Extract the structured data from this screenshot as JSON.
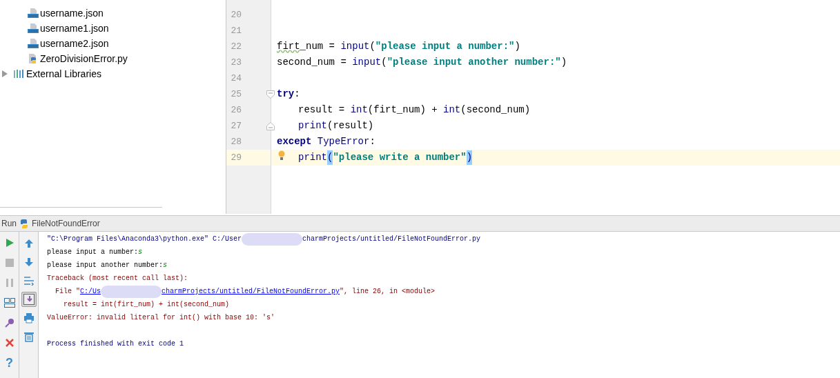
{
  "project_tree": {
    "files": [
      {
        "kind": "json",
        "label": "username.json"
      },
      {
        "kind": "json",
        "label": "username1.json"
      },
      {
        "kind": "json",
        "label": "username2.json"
      },
      {
        "kind": "python",
        "label": "ZeroDivisionError.py"
      }
    ],
    "external": {
      "label": "External Libraries",
      "expanded": false
    }
  },
  "editor": {
    "lines": [
      {
        "number": "20",
        "indented": false,
        "current": false,
        "bulb": false,
        "fold_start": false,
        "fold_end": false
      },
      {
        "number": "21",
        "indented": false,
        "current": false,
        "bulb": false,
        "fold_start": false,
        "fold_end": false
      },
      {
        "number": "22",
        "indented": false,
        "current": false,
        "bulb": false,
        "fold_start": false,
        "fold_end": false,
        "tokens": [
          {
            "kind": "typo",
            "text": "firt"
          },
          {
            "kind": "plain",
            "text": "_num = "
          },
          {
            "kind": "builtin",
            "text": "input"
          },
          {
            "kind": "plain",
            "text": "("
          },
          {
            "kind": "string",
            "text": "\"please input a number:\""
          },
          {
            "kind": "plain",
            "text": ")"
          }
        ]
      },
      {
        "number": "23",
        "indented": false,
        "current": false,
        "bulb": false,
        "fold_start": false,
        "fold_end": false,
        "tokens": [
          {
            "kind": "plain",
            "text": "second_num = "
          },
          {
            "kind": "builtin",
            "text": "input"
          },
          {
            "kind": "plain",
            "text": "("
          },
          {
            "kind": "string",
            "text": "\"please input another number:\""
          },
          {
            "kind": "plain",
            "text": ")"
          }
        ]
      },
      {
        "number": "24",
        "indented": false,
        "current": false,
        "bulb": false,
        "fold_start": false,
        "fold_end": false
      },
      {
        "number": "25",
        "indented": false,
        "current": false,
        "bulb": false,
        "fold_start": true,
        "fold_end": false,
        "tokens": [
          {
            "kind": "keyword",
            "text": "try"
          },
          {
            "kind": "plain",
            "text": ":"
          }
        ]
      },
      {
        "number": "26",
        "indented": true,
        "current": false,
        "bulb": false,
        "fold_start": false,
        "fold_end": false,
        "tokens": [
          {
            "kind": "plain",
            "text": "result = "
          },
          {
            "kind": "builtin",
            "text": "int"
          },
          {
            "kind": "plain",
            "text": "(firt_num) + "
          },
          {
            "kind": "builtin",
            "text": "int"
          },
          {
            "kind": "plain",
            "text": "(second_num)"
          }
        ]
      },
      {
        "number": "27",
        "indented": true,
        "current": false,
        "bulb": false,
        "fold_start": false,
        "fold_end": true,
        "tokens": [
          {
            "kind": "builtin",
            "text": "print"
          },
          {
            "kind": "plain",
            "text": "(result)"
          }
        ]
      },
      {
        "number": "28",
        "indented": false,
        "current": false,
        "bulb": false,
        "fold_start": false,
        "fold_end": false,
        "tokens": [
          {
            "kind": "keyword",
            "text": "except"
          },
          {
            "kind": "class",
            "text": "TypeError"
          },
          {
            "kind": "plain",
            "text": ":"
          }
        ]
      },
      {
        "number": "29",
        "indented": true,
        "current": true,
        "bulb": true,
        "fold_start": false,
        "fold_end": false,
        "tokens": [
          {
            "kind": "builtin",
            "text": "print"
          },
          {
            "kind": "brace",
            "text": "("
          },
          {
            "kind": "string",
            "text": "\"please write a number\""
          },
          {
            "kind": "brace",
            "text": ")"
          }
        ]
      }
    ]
  },
  "run_panel": {
    "label": "Run",
    "config": "FileNotFoundError",
    "left_tools": [
      {
        "kind": "run",
        "disabled": false
      },
      {
        "kind": "stop",
        "disabled": true
      },
      {
        "kind": "pause",
        "disabled": true
      },
      {
        "kind": "layout",
        "disabled": false
      },
      {
        "kind": "pin",
        "disabled": false
      },
      {
        "kind": "close",
        "disabled": false
      },
      {
        "kind": "help",
        "disabled": false,
        "glyph": "?"
      }
    ],
    "right_tools": [
      {
        "kind": "up",
        "selected": false
      },
      {
        "kind": "down",
        "selected": false
      },
      {
        "kind": "wrap",
        "selected": false
      },
      {
        "kind": "scroll-end",
        "selected": true
      },
      {
        "kind": "print",
        "selected": false
      },
      {
        "kind": "trash",
        "selected": false
      }
    ],
    "console": [
      {
        "kind": "text",
        "segments": [
          {
            "kind": "system",
            "text": "\"C:\\Program Files\\Anaconda3\\python.exe\" C:/User"
          },
          {
            "kind": "redacted"
          },
          {
            "kind": "system",
            "text": "charmProjects/untitled/FileNotFoundError.py"
          }
        ]
      },
      {
        "kind": "text",
        "segments": [
          {
            "kind": "output",
            "text": "please input a number:"
          },
          {
            "kind": "input",
            "text": "s"
          }
        ]
      },
      {
        "kind": "text",
        "segments": [
          {
            "kind": "output",
            "text": "please input another number:"
          },
          {
            "kind": "input",
            "text": "s"
          }
        ]
      },
      {
        "kind": "text",
        "segments": [
          {
            "kind": "error",
            "text": "Traceback (most recent call last):"
          }
        ]
      },
      {
        "kind": "text",
        "segments": [
          {
            "kind": "error",
            "text": "  File \""
          },
          {
            "kind": "link",
            "text": "C:/Us"
          },
          {
            "kind": "redacted"
          },
          {
            "kind": "link",
            "text": "charmProjects/untitled/FileNotFoundError.py"
          },
          {
            "kind": "error",
            "text": "\", line 26, in <module>"
          }
        ]
      },
      {
        "kind": "text",
        "segments": [
          {
            "kind": "error",
            "text": "    result = int(firt_num) + int(second_num)"
          }
        ]
      },
      {
        "kind": "text",
        "segments": [
          {
            "kind": "error",
            "text": "ValueError: invalid literal for int() with base 10: 's'"
          }
        ]
      },
      {
        "kind": "blank"
      },
      {
        "kind": "text",
        "segments": [
          {
            "kind": "system",
            "text": "Process finished with exit code 1"
          }
        ]
      }
    ]
  }
}
